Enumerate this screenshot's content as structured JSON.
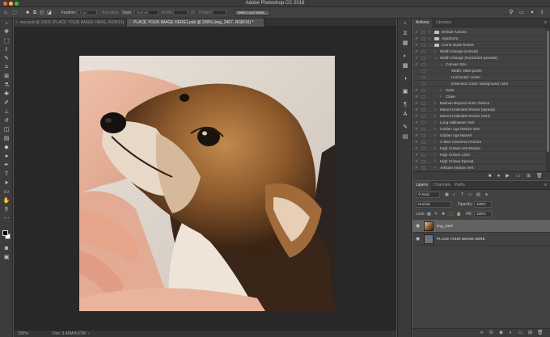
{
  "window": {
    "title": "Adobe Photoshop CC 2018"
  },
  "options_bar": {
    "feather_label": "Feather:",
    "feather_value": "0 px",
    "antialias_label": "Anti-alias",
    "style_label": "Style:",
    "style_value": "Normal",
    "width_label": "Width:",
    "height_label": "Height:",
    "select_mask_label": "Select and Mask..."
  },
  "tabs": [
    {
      "label": "test.psd @ 166% (PLACE YOUR IMAGE HERE, RGB/16)",
      "active": false
    },
    {
      "label": "PLACE YOUR IMAGE HERE1.psb @ 200% (img_2467, RGB/16) *",
      "active": true
    }
  ],
  "status_bar": {
    "zoom": "200%",
    "doc": "Doc: 3.40M/4.67M"
  },
  "panels": {
    "top_tabs": [
      "Actions",
      "Libraries"
    ],
    "actions": [
      {
        "label": "Default Actions",
        "kind": "set",
        "indent": 0,
        "checked": true,
        "expanded": false
      },
      {
        "label": "AppStorm",
        "kind": "set",
        "indent": 0,
        "checked": true,
        "expanded": false
      },
      {
        "label": "Comic Book Resize",
        "kind": "set",
        "indent": 0,
        "checked": true,
        "expanded": true
      },
      {
        "label": "Width change (vertical)",
        "kind": "action",
        "indent": 1,
        "checked": true,
        "expanded": false
      },
      {
        "label": "Width Change (horizontal spreads)",
        "kind": "action",
        "indent": 1,
        "checked": true,
        "expanded": true
      },
      {
        "label": "Canvas Size",
        "kind": "step",
        "indent": 2,
        "checked": true,
        "expanded": true
      },
      {
        "label": "Width: 2650 pixels",
        "kind": "detail",
        "indent": 3,
        "checked": false,
        "expanded": false
      },
      {
        "label": "Horizontal: center",
        "kind": "detail",
        "indent": 3,
        "checked": false,
        "expanded": false
      },
      {
        "label": "Extension Color: background color",
        "kind": "detail",
        "indent": 3,
        "checked": false,
        "expanded": false
      },
      {
        "label": "Save",
        "kind": "step",
        "indent": 2,
        "checked": true,
        "expanded": false
      },
      {
        "label": "Close",
        "kind": "step",
        "indent": 2,
        "checked": true,
        "expanded": false
      },
      {
        "label": "Batman Beyond Horiz. Resize",
        "kind": "action",
        "indent": 1,
        "checked": true,
        "expanded": false
      },
      {
        "label": "Marvel Unlimited Resize (spread)",
        "kind": "action",
        "indent": 1,
        "checked": true,
        "expanded": false
      },
      {
        "label": "Marvel Unlimited Resize (vert)",
        "kind": "action",
        "indent": 1,
        "checked": true,
        "expanded": false
      },
      {
        "label": "Long Halloween Vert",
        "kind": "action",
        "indent": 1,
        "checked": true,
        "expanded": false
      },
      {
        "label": "Golden Age Resize Vert",
        "kind": "action",
        "indent": 1,
        "checked": true,
        "expanded": false
      },
      {
        "label": "Golden Age Marvel",
        "kind": "action",
        "indent": 1,
        "checked": true,
        "expanded": false
      },
      {
        "label": "X-Men Claremont Resize",
        "kind": "action",
        "indent": 1,
        "checked": true,
        "expanded": false
      },
      {
        "label": "High Crimes Vert Resize",
        "kind": "action",
        "indent": 1,
        "checked": true,
        "expanded": false
      },
      {
        "label": "High Crimes 1303",
        "kind": "action",
        "indent": 1,
        "checked": true,
        "expanded": false
      },
      {
        "label": "High Crimes Spread",
        "kind": "action",
        "indent": 1,
        "checked": true,
        "expanded": false
      },
      {
        "label": "Arkham Asylum Vert",
        "kind": "action",
        "indent": 1,
        "checked": true,
        "expanded": false
      }
    ],
    "layer_tabs": [
      "Layers",
      "Channels",
      "Paths"
    ],
    "layers": {
      "filter_label": "Kind",
      "blend_mode": "Normal",
      "opacity_label": "Opacity:",
      "opacity_value": "100%",
      "lock_label": "Lock:",
      "fill_label": "Fill:",
      "fill_value": "100%",
      "items": [
        {
          "name": "img_2467",
          "selected": true,
          "thumb": "photo"
        },
        {
          "name": "PLACE YOUR IMAGE HERE",
          "selected": false,
          "thumb": "placeholder"
        }
      ]
    }
  },
  "colors": {
    "canvas_bg": "#282828",
    "panel_bg": "#424242",
    "selected_layer": "#626262",
    "traffic_close": "#fc5f57",
    "traffic_min": "#fdbc2e",
    "traffic_max": "#28c840"
  }
}
